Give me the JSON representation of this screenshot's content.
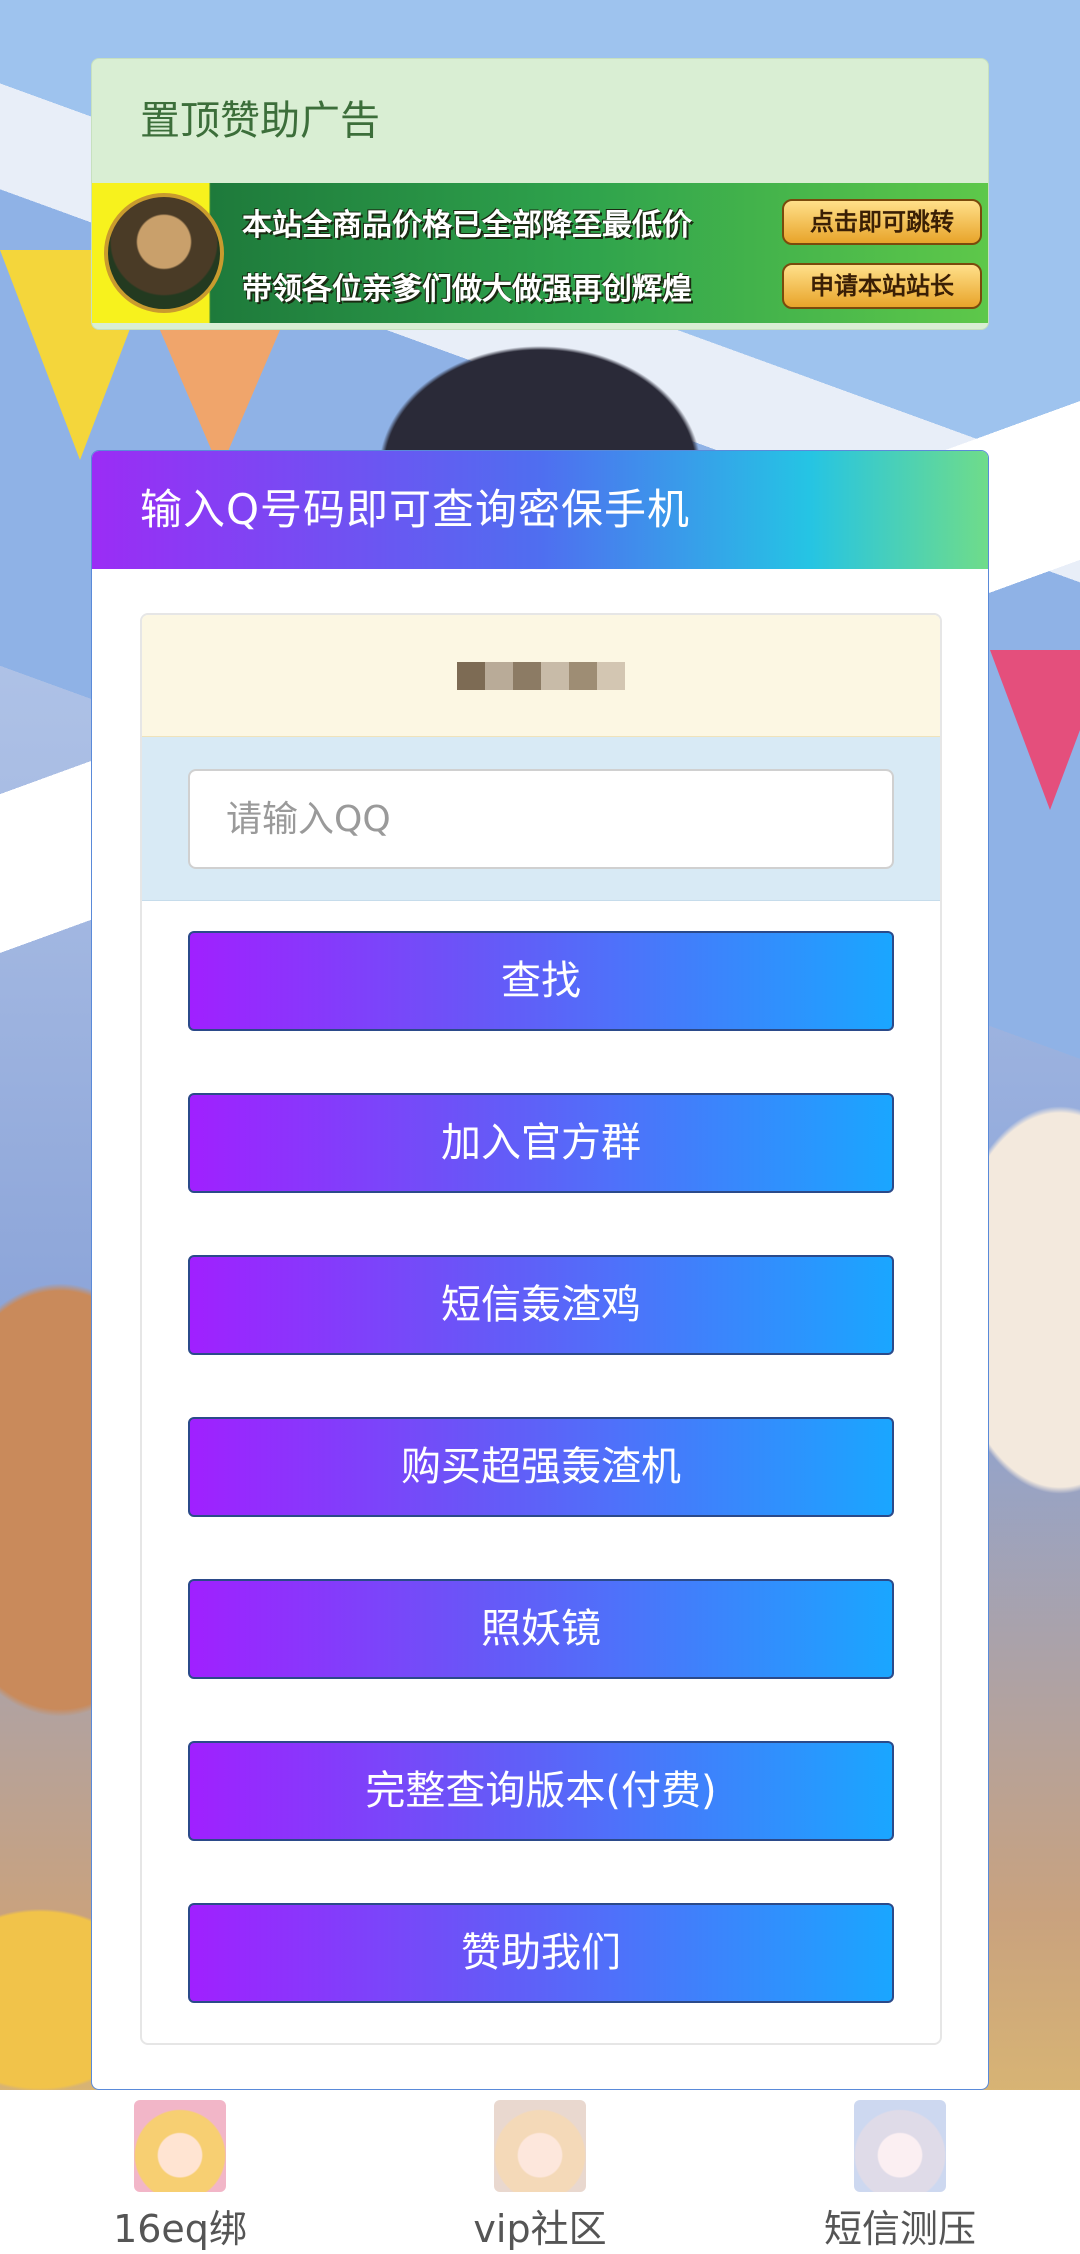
{
  "ad": {
    "title": "置顶赞助广告",
    "banner": {
      "line1": "本站全商品价格已全部降至最低价",
      "button1": "点击即可跳转",
      "line2": "带领各位亲爹们做大做强再创辉煌",
      "button2": "申请本站站长"
    }
  },
  "main": {
    "header": "输入Q号码即可查询密保手机",
    "notice_mosaic_colors": [
      "#7d6b54",
      "#b9ab98",
      "#8c7b64",
      "#c8bba8",
      "#9e8d74",
      "#d3c6b2"
    ],
    "input": {
      "placeholder": "请输入QQ",
      "value": ""
    },
    "buttons": [
      "查找",
      "加入官方群",
      "短信轰渣鸡",
      "购买超强轰渣机",
      "照妖镜",
      "完整查询版本(付费)",
      "赞助我们"
    ]
  },
  "bottom_nav": [
    {
      "label": "16eq绑",
      "icon": "avatar-blonde-girl"
    },
    {
      "label": "vip社区",
      "icon": "avatar-light-hair-girl"
    },
    {
      "label": "短信测压",
      "icon": "avatar-white-hair-girl"
    }
  ],
  "colors": {
    "button_gradient_start": "#a020ff",
    "button_gradient_end": "#1aa6ff",
    "ad_panel_bg": "#d9eed3",
    "notice_bg": "#fcf7e3",
    "input_area_bg": "#d8eaf5"
  }
}
